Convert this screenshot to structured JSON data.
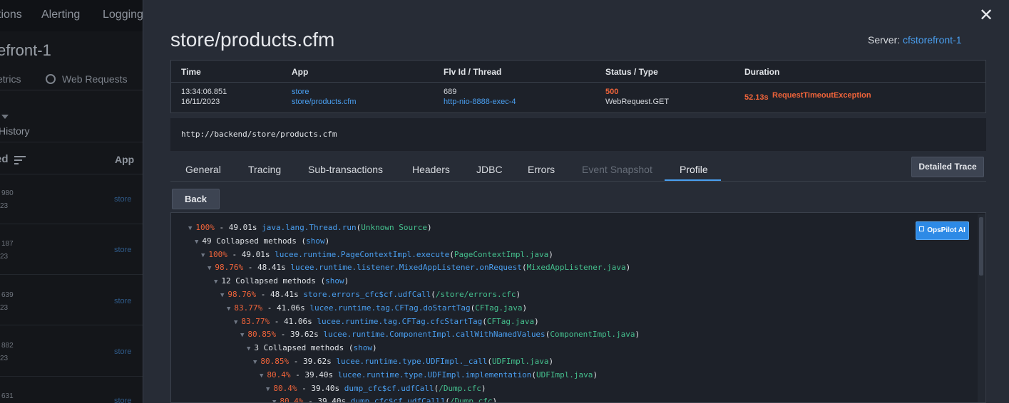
{
  "background": {
    "nav": [
      "tions",
      "Alerting",
      "Logging"
    ],
    "title": "efront-1",
    "tabs": [
      "etrics",
      "Web Requests"
    ],
    "history_label": "History",
    "column_header": "ed",
    "app_header": "App",
    "rows": [
      {
        "num": "980",
        "year": "23",
        "app": "store"
      },
      {
        "num": "187",
        "year": "23",
        "app": "store"
      },
      {
        "num": "639",
        "year": "23",
        "app": "store"
      },
      {
        "num": "882",
        "year": "23",
        "app": "store"
      },
      {
        "num": "631",
        "year": "",
        "app": "store"
      }
    ]
  },
  "modal": {
    "title": "store/products.cfm",
    "server_label": "Server:",
    "server_name": "cfstorefront-1",
    "transaction": {
      "headers": {
        "time": "Time",
        "app": "App",
        "thread": "Flv Id / Thread",
        "status": "Status / Type",
        "duration": "Duration"
      },
      "time": "13:34:06.851",
      "date": "16/11/2023",
      "app": "store",
      "app_page": "store/products.cfm",
      "flv_id": "689",
      "thread": "http-nio-8888-exec-4",
      "status": "500",
      "type": "WebRequest.GET",
      "duration": "52.13s",
      "exception": "RequestTimeoutException"
    },
    "url": "http://backend/store/products.cfm",
    "tabs": [
      {
        "label": "General",
        "disabled": false
      },
      {
        "label": "Tracing",
        "disabled": false
      },
      {
        "label": "Sub-transactions",
        "disabled": false
      },
      {
        "label": "Headers",
        "disabled": false
      },
      {
        "label": "JDBC",
        "disabled": false
      },
      {
        "label": "Errors",
        "disabled": false
      },
      {
        "label": "Event Snapshot",
        "disabled": true
      },
      {
        "label": "Profile",
        "disabled": false,
        "active": true
      }
    ],
    "detailed_trace_label": "Detailed Trace",
    "back_label": "Back",
    "opspilot_label": "OpsPilot AI",
    "profile": [
      {
        "type": "method",
        "pct": "100%",
        "time": "49.01s",
        "fn": "java.lang.Thread.run",
        "src": "Unknown Source"
      },
      {
        "type": "collapsed",
        "text": "49 Collapsed methods",
        "show": "show"
      },
      {
        "type": "method",
        "pct": "100%",
        "time": "49.01s",
        "fn": "lucee.runtime.PageContextImpl.execute",
        "src": "PageContextImpl.java"
      },
      {
        "type": "method",
        "pct": "98.76%",
        "time": "48.41s",
        "fn": "lucee.runtime.listener.MixedAppListener.onRequest",
        "src": "MixedAppListener.java"
      },
      {
        "type": "collapsed",
        "text": "12 Collapsed methods",
        "show": "show"
      },
      {
        "type": "method",
        "pct": "98.76%",
        "time": "48.41s",
        "fn": "store.errors_cfc$cf.udfCall",
        "src": "/store/errors.cfc"
      },
      {
        "type": "method",
        "pct": "83.77%",
        "time": "41.06s",
        "fn": "lucee.runtime.tag.CFTag.doStartTag",
        "src": "CFTag.java"
      },
      {
        "type": "method",
        "pct": "83.77%",
        "time": "41.06s",
        "fn": "lucee.runtime.tag.CFTag.cfcStartTag",
        "src": "CFTag.java"
      },
      {
        "type": "method",
        "pct": "80.85%",
        "time": "39.62s",
        "fn": "lucee.runtime.ComponentImpl.callWithNamedValues",
        "src": "ComponentImpl.java"
      },
      {
        "type": "collapsed",
        "text": "3 Collapsed methods",
        "show": "show"
      },
      {
        "type": "method",
        "pct": "80.85%",
        "time": "39.62s",
        "fn": "lucee.runtime.type.UDFImpl._call",
        "src": "UDFImpl.java"
      },
      {
        "type": "method",
        "pct": "80.4%",
        "time": "39.40s",
        "fn": "lucee.runtime.type.UDFImpl.implementation",
        "src": "UDFImpl.java"
      },
      {
        "type": "method",
        "pct": "80.4%",
        "time": "39.40s",
        "fn": "dump_cfc$cf.udfCall",
        "src": "/Dump.cfc"
      },
      {
        "type": "method",
        "pct": "80.4%",
        "time": "39.40s",
        "fn": "dump_cfc$cf.udfCall1",
        "src": "/Dump.cfc"
      }
    ]
  }
}
